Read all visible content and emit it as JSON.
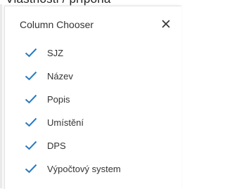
{
  "background": {
    "partial_text": "Vlastnosti / přípona"
  },
  "dialog": {
    "title": "Column Chooser",
    "close_icon": "close-icon"
  },
  "columns": [
    {
      "label": "SJZ",
      "checked": true
    },
    {
      "label": "Název",
      "checked": true
    },
    {
      "label": "Popis",
      "checked": true
    },
    {
      "label": "Umístění",
      "checked": true
    },
    {
      "label": "DPS",
      "checked": true
    },
    {
      "label": "Výpočtový system",
      "checked": true
    }
  ],
  "colors": {
    "check": "#2a7abf",
    "text": "#333333"
  }
}
